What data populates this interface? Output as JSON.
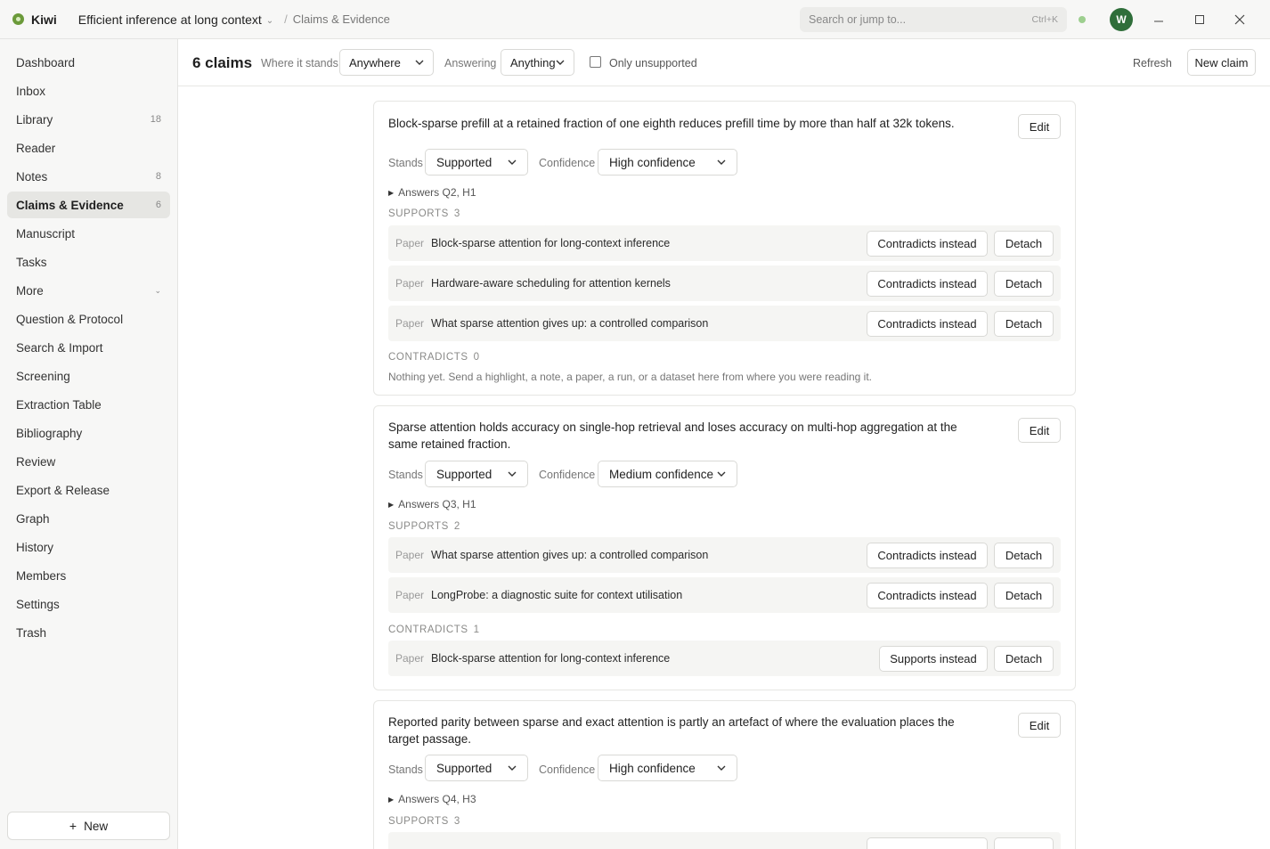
{
  "app": {
    "name": "Kiwi",
    "project": "Efficient inference at long context",
    "breadcrumb": "Claims & Evidence",
    "search_placeholder": "Search or jump to...",
    "search_shortcut": "Ctrl+K",
    "user_initial": "W"
  },
  "sidebar": {
    "items": [
      {
        "label": "Dashboard",
        "count": ""
      },
      {
        "label": "Inbox",
        "count": ""
      },
      {
        "label": "Library",
        "count": "18"
      },
      {
        "label": "Reader",
        "count": ""
      },
      {
        "label": "Notes",
        "count": "8"
      },
      {
        "label": "Claims & Evidence",
        "count": "6"
      },
      {
        "label": "Manuscript",
        "count": ""
      },
      {
        "label": "Tasks",
        "count": ""
      },
      {
        "label": "More",
        "count": ""
      },
      {
        "label": "Question & Protocol",
        "count": ""
      },
      {
        "label": "Search & Import",
        "count": ""
      },
      {
        "label": "Screening",
        "count": ""
      },
      {
        "label": "Extraction Table",
        "count": ""
      },
      {
        "label": "Bibliography",
        "count": ""
      },
      {
        "label": "Review",
        "count": ""
      },
      {
        "label": "Export & Release",
        "count": ""
      },
      {
        "label": "Graph",
        "count": ""
      },
      {
        "label": "History",
        "count": ""
      },
      {
        "label": "Members",
        "count": ""
      },
      {
        "label": "Settings",
        "count": ""
      },
      {
        "label": "Trash",
        "count": ""
      }
    ],
    "active": "Claims & Evidence",
    "new_label": "New"
  },
  "toolbar": {
    "count_label": "6 claims",
    "where_label": "Where it stands",
    "where_value": "Anywhere",
    "answering_label": "Answering",
    "answering_value": "Anything",
    "only_unsupported_label": "Only unsupported",
    "refresh_label": "Refresh",
    "new_claim_label": "New claim"
  },
  "labels": {
    "edit": "Edit",
    "stands": "Stands",
    "confidence": "Confidence",
    "supports": "SUPPORTS",
    "contradicts": "CONTRADICTS",
    "paper": "Paper",
    "contradicts_instead": "Contradicts instead",
    "supports_instead": "Supports instead",
    "detach": "Detach"
  },
  "claims": [
    {
      "text": "Block-sparse prefill at a retained fraction of one eighth reduces prefill time by more than half at 32k tokens.",
      "stands": "Supported",
      "confidence": "High confidence",
      "answers": "Answers Q2, H1",
      "supports_count": "3",
      "supports": [
        "Block-sparse attention for long-context inference",
        "Hardware-aware scheduling for attention kernels",
        "What sparse attention gives up: a controlled comparison"
      ],
      "contradicts_count": "0",
      "contradicts": [],
      "empty_note": "Nothing yet. Send a highlight, a note, a paper, a run, or a dataset here from where you were reading it."
    },
    {
      "text": "Sparse attention holds accuracy on single-hop retrieval and loses accuracy on multi-hop aggregation at the same retained fraction.",
      "stands": "Supported",
      "confidence": "Medium confidence",
      "answers": "Answers Q3, H1",
      "supports_count": "2",
      "supports": [
        "What sparse attention gives up: a controlled comparison",
        "LongProbe: a diagnostic suite for context utilisation"
      ],
      "contradicts_count": "1",
      "contradicts": [
        "Block-sparse attention for long-context inference"
      ]
    },
    {
      "text": "Reported parity between sparse and exact attention is partly an artefact of where the evaluation places the target passage.",
      "stands": "Supported",
      "confidence": "High confidence",
      "answers": "Answers Q4, H3",
      "supports_count": "3"
    }
  ]
}
